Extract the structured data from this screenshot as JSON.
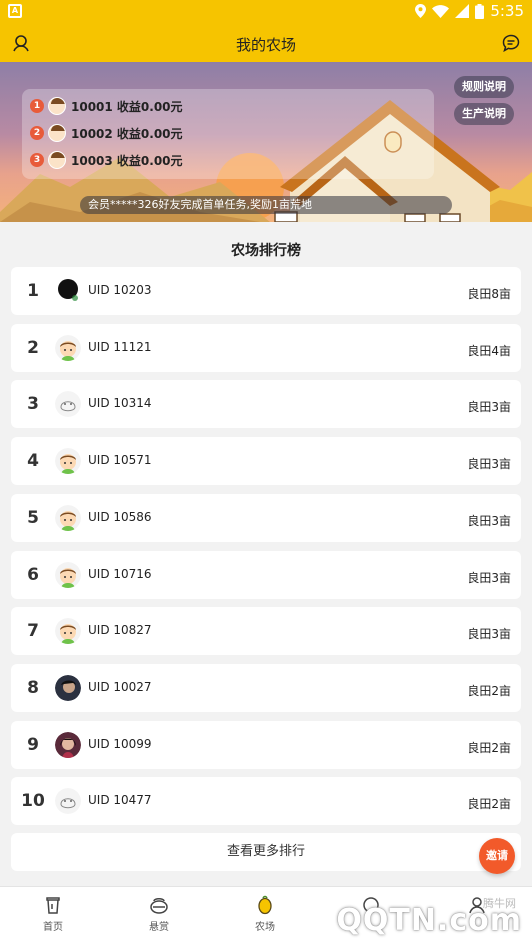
{
  "status_bar": {
    "time": "5:35"
  },
  "header": {
    "title": "我的农场"
  },
  "banner": {
    "top_ranks": [
      {
        "rank": "1",
        "text": "10001 收益0.00元"
      },
      {
        "rank": "2",
        "text": "10002 收益0.00元"
      },
      {
        "rank": "3",
        "text": "10003 收益0.00元"
      }
    ],
    "rules_label": "规则说明",
    "production_label": "生产说明",
    "marquee": "会员*****326好友完成首单任务,奖励1亩荒地"
  },
  "leaderboard": {
    "title": "农场排行榜",
    "rows": [
      {
        "rank": "1",
        "uid": "UID 10203",
        "land": "良田8亩",
        "avatar": "dark-icon"
      },
      {
        "rank": "2",
        "uid": "UID 11121",
        "land": "良田4亩",
        "avatar": "boy-icon"
      },
      {
        "rank": "3",
        "uid": "UID 10314",
        "land": "良田3亩",
        "avatar": "sketch-icon"
      },
      {
        "rank": "4",
        "uid": "UID 10571",
        "land": "良田3亩",
        "avatar": "boy-icon"
      },
      {
        "rank": "5",
        "uid": "UID 10586",
        "land": "良田3亩",
        "avatar": "boy-icon"
      },
      {
        "rank": "6",
        "uid": "UID 10716",
        "land": "良田3亩",
        "avatar": "boy-icon"
      },
      {
        "rank": "7",
        "uid": "UID 10827",
        "land": "良田3亩",
        "avatar": "boy-icon"
      },
      {
        "rank": "8",
        "uid": "UID 10027",
        "land": "良田2亩",
        "avatar": "photo-icon"
      },
      {
        "rank": "9",
        "uid": "UID 10099",
        "land": "良田2亩",
        "avatar": "photo2-icon"
      },
      {
        "rank": "10",
        "uid": "UID 10477",
        "land": "良田2亩",
        "avatar": "sketch-icon"
      }
    ],
    "more_label": "查看更多排行"
  },
  "invite_label": "邀请",
  "tabs": [
    {
      "label": "首页",
      "icon": "home-icon"
    },
    {
      "label": "悬赏",
      "icon": "reward-icon"
    },
    {
      "label": "农场",
      "icon": "farm-icon"
    },
    {
      "label": "",
      "icon": "other-icon"
    },
    {
      "label": "",
      "icon": "mine-icon"
    }
  ],
  "watermark": {
    "small": "腾牛网",
    "big": "QQTN.com"
  },
  "colors": {
    "brand": "#f6c400",
    "invite": "#f25a2a",
    "rank_badge": "#e85b3a"
  }
}
